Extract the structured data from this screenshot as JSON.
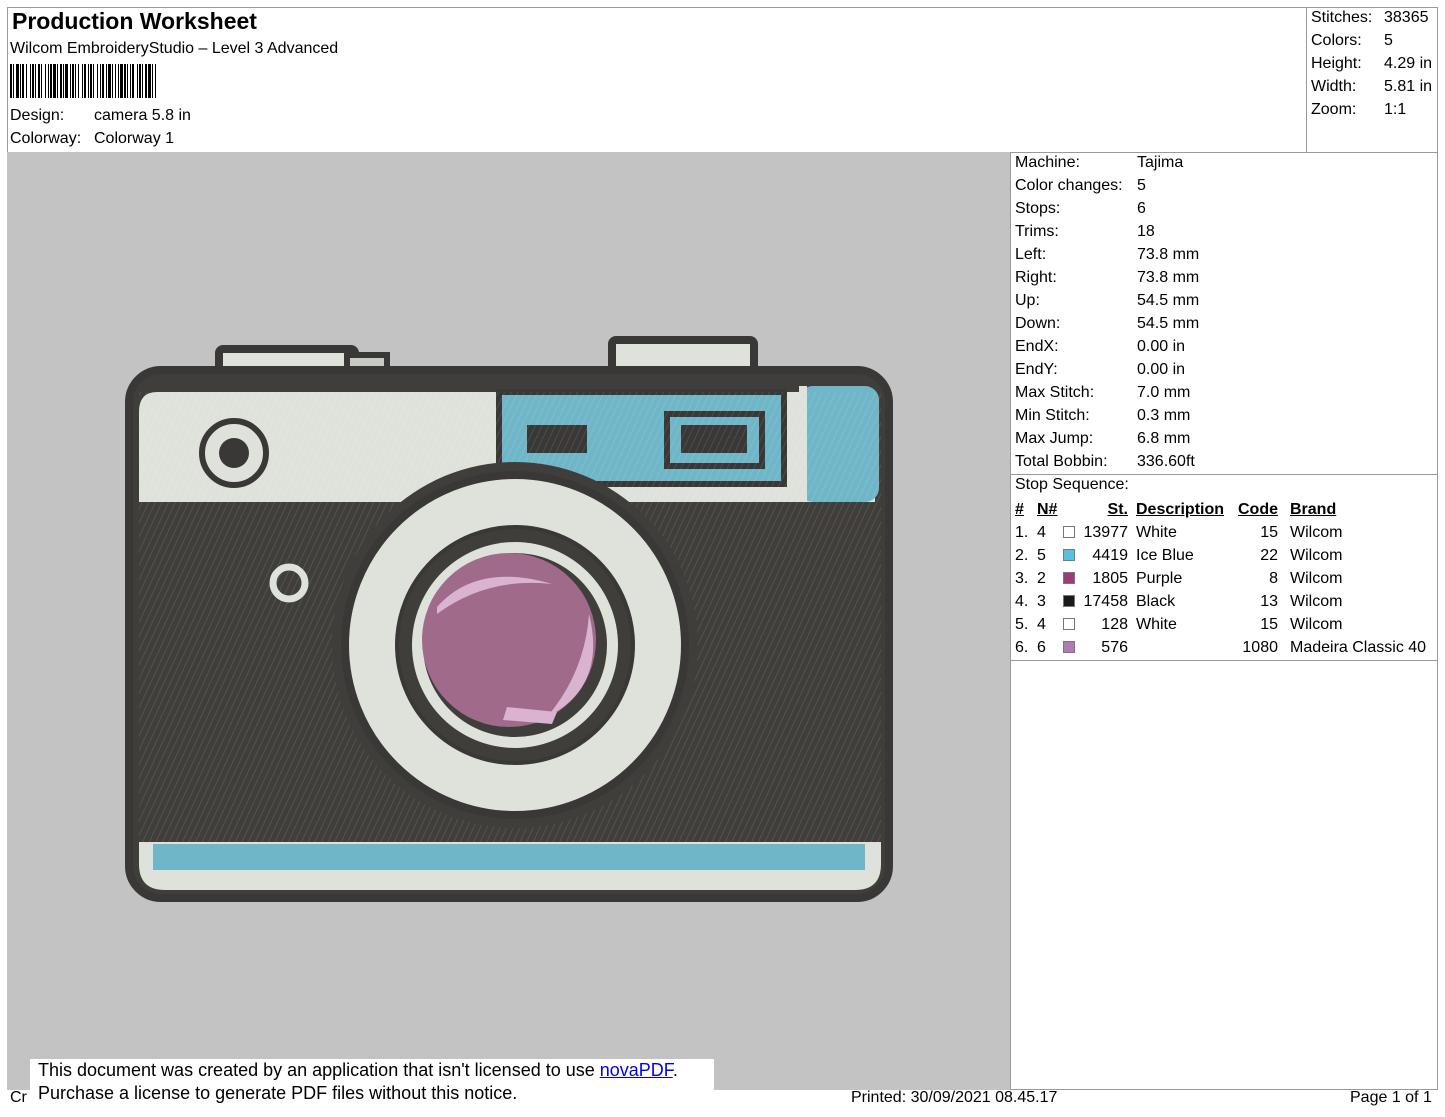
{
  "header": {
    "title": "Production Worksheet",
    "subtitle": "Wilcom EmbroideryStudio – Level 3 Advanced",
    "design_label": "Design:",
    "design_value": "camera 5.8 in",
    "colorway_label": "Colorway:",
    "colorway_value": "Colorway 1"
  },
  "summary": [
    {
      "label": "Stitches:",
      "value": "38365"
    },
    {
      "label": "Colors:",
      "value": "5"
    },
    {
      "label": "Height:",
      "value": "4.29 in"
    },
    {
      "label": "Width:",
      "value": "5.81 in"
    },
    {
      "label": "Zoom:",
      "value": "1:1"
    }
  ],
  "machine_stats": [
    {
      "label": "Machine:",
      "value": "Tajima"
    },
    {
      "label": "Color changes:",
      "value": "5"
    },
    {
      "label": "Stops:",
      "value": "6"
    },
    {
      "label": "Trims:",
      "value": "18"
    },
    {
      "label": "Left:",
      "value": "73.8 mm"
    },
    {
      "label": "Right:",
      "value": "73.8 mm"
    },
    {
      "label": "Up:",
      "value": "54.5 mm"
    },
    {
      "label": "Down:",
      "value": "54.5 mm"
    },
    {
      "label": "EndX:",
      "value": "0.00 in"
    },
    {
      "label": "EndY:",
      "value": "0.00 in"
    },
    {
      "label": "Max Stitch:",
      "value": "7.0 mm"
    },
    {
      "label": "Min Stitch:",
      "value": "0.3 mm"
    },
    {
      "label": "Max Jump:",
      "value": "6.8 mm"
    },
    {
      "label": "Total Bobbin:",
      "value": "336.60ft"
    }
  ],
  "stop_sequence": {
    "title": "Stop Sequence:",
    "headers": [
      "#",
      "N#",
      "St.",
      "Description",
      "Code",
      "Brand"
    ],
    "rows": [
      {
        "num": "1.",
        "n": "4",
        "color": "#ffffff",
        "st": "13977",
        "desc": "White",
        "code": "15",
        "brand": "Wilcom"
      },
      {
        "num": "2.",
        "n": "5",
        "color": "#5bbfe0",
        "st": "4419",
        "desc": "Ice Blue",
        "code": "22",
        "brand": "Wilcom"
      },
      {
        "num": "3.",
        "n": "2",
        "color": "#9b3b78",
        "st": "1805",
        "desc": "Purple",
        "code": "8",
        "brand": "Wilcom"
      },
      {
        "num": "4.",
        "n": "3",
        "color": "#1a1a1a",
        "st": "17458",
        "desc": "Black",
        "code": "13",
        "brand": "Wilcom"
      },
      {
        "num": "5.",
        "n": "4",
        "color": "#ffffff",
        "st": "128",
        "desc": "White",
        "code": "15",
        "brand": "Wilcom"
      },
      {
        "num": "6.",
        "n": "6",
        "color": "#b07ab5",
        "st": "576",
        "desc": "",
        "code": "1080",
        "brand": "Madeira Classic 40"
      }
    ]
  },
  "design_colors": {
    "outline": "#3a3836",
    "body": "#403e3b",
    "cream": "#dfe2da",
    "ice_blue": "#6fb6c8",
    "lens_purple": "#a06a8a",
    "lens_highlight": "#d9b3d0",
    "background": "#c3c3c3"
  },
  "notice": {
    "line1_prefix": "This document was created by an application that isn't licensed to use ",
    "link": "novaPDF",
    "line1_suffix": ".",
    "line2": "Purchase a license to generate PDF files without this notice."
  },
  "footer": {
    "left_fragment": "Cr",
    "printed": "Printed: 30/09/2021 08.45.17",
    "page": "Page 1 of 1"
  }
}
